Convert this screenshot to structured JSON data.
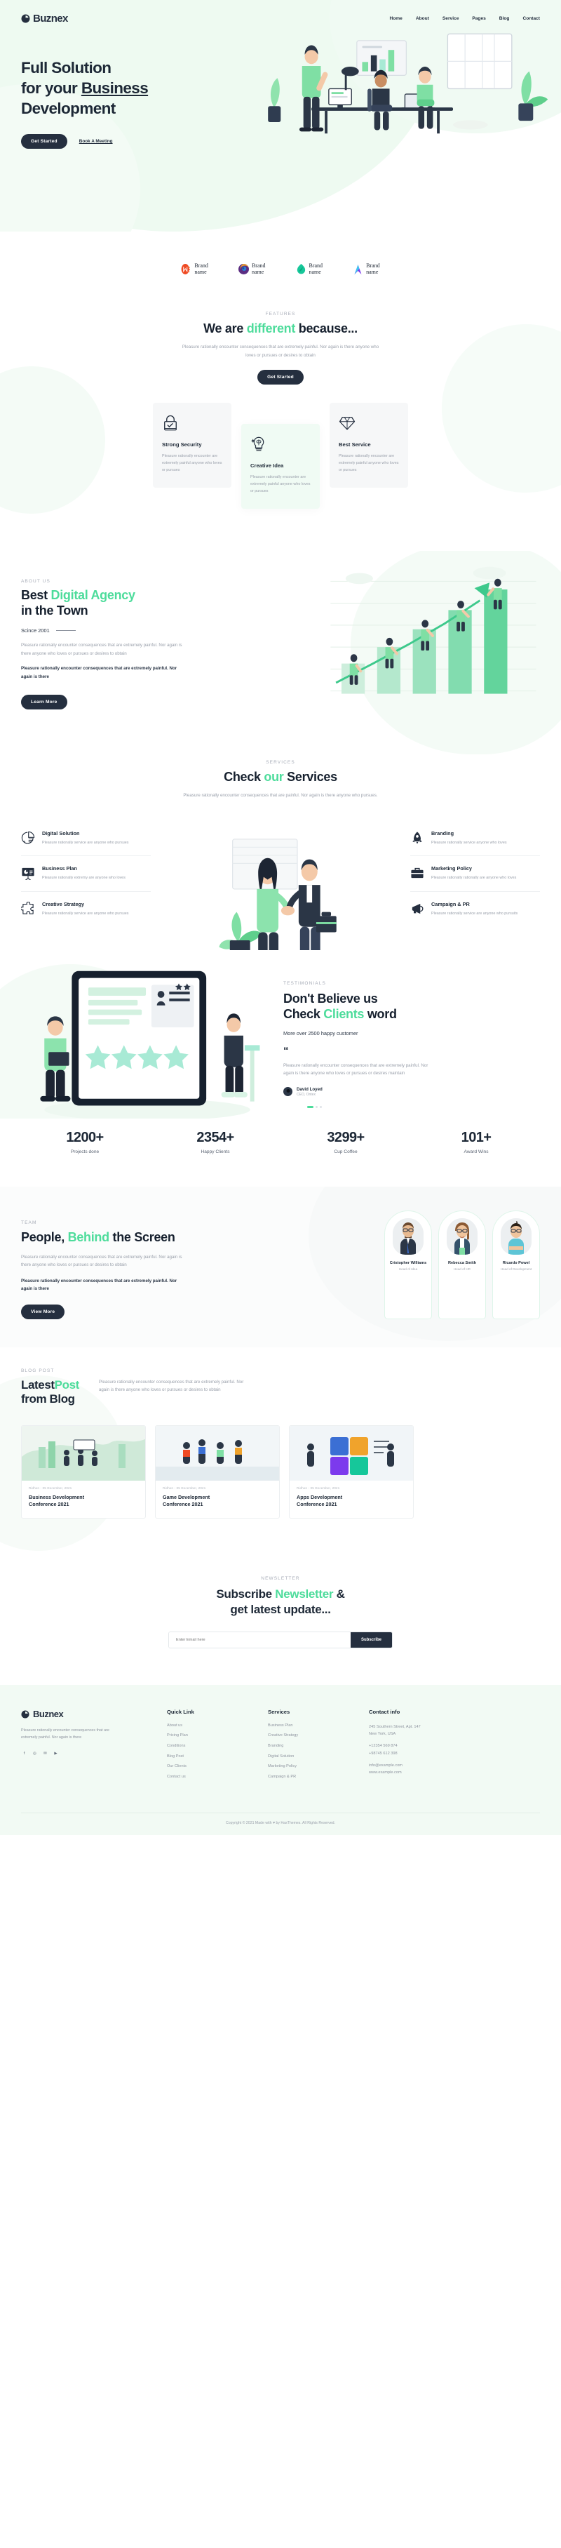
{
  "brand": {
    "name": "Buznex",
    "logo_icon": "circle-split-icon"
  },
  "nav": {
    "items": [
      {
        "label": "Home"
      },
      {
        "label": "About"
      },
      {
        "label": "Service"
      },
      {
        "label": "Pages"
      },
      {
        "label": "Blog"
      },
      {
        "label": "Contact"
      }
    ]
  },
  "hero": {
    "line1": "Full Solution",
    "line2_pre": "for your ",
    "line2_underlined": "Business",
    "line3": "Development",
    "primary_cta": "Get Started",
    "secondary_cta": "Book A Meeting"
  },
  "brands": {
    "items": [
      {
        "name_line1": "Brand",
        "name_line2": "name",
        "color": "#ef4a23",
        "icon": "m-dots-logo-icon"
      },
      {
        "name_line1": "Brand",
        "name_line2": "name",
        "color": "#3b6fd4",
        "icon": "swirl-logo-icon"
      },
      {
        "name_line1": "Brand",
        "name_line2": "name",
        "color": "#16c79a",
        "icon": "leaf-logo-icon"
      },
      {
        "name_line1": "Brand",
        "name_line2": "name",
        "color": "#7c3aed",
        "icon": "peak-logo-icon"
      }
    ]
  },
  "features": {
    "label": "FEATURES",
    "title_pre": "We are ",
    "title_accent": "different",
    "title_post": " because...",
    "subtitle": "Pleasure rationally encounter consequences that are extremely painful. Nor again is there anyone who loves or pursues or desires to obtain",
    "cta": "Get Started",
    "cards": [
      {
        "icon": "padlock-check-icon",
        "title": "Strong Security",
        "text": "Pleasure rationally encounter are extremely painful anyone who loves or pursues"
      },
      {
        "icon": "brain-bulb-icon",
        "title": "Creative Idea",
        "text": "Pleasure rationally encounter are extremely painful anyone who loves or pursues"
      },
      {
        "icon": "diamond-icon",
        "title": "Best Service",
        "text": "Pleasure rationally encounter are extremely painful anyone who loves or pursues"
      }
    ]
  },
  "about": {
    "label": "ABOUT US",
    "title_pre": "Best ",
    "title_accent": "Digital Agency",
    "title_post": "in the Town",
    "since": "Scince 2001",
    "paragraph1": "Pleasure rationally encounter consequences that are extremely painful. Nor again is there anyone who loves or pursues or desires to obtain",
    "paragraph2": "Pleasure rationally encounter consequences that are extremely painful. Nor again is there",
    "cta": "Learn More"
  },
  "services": {
    "label": "SERVICES",
    "title_pre": "Check ",
    "title_accent": "our",
    "title_post": " Services",
    "subtitle": "Pleasure rationally encounter consequences that are painful. Nor again is there anyone who pursues.",
    "left": [
      {
        "icon": "pie-chart-icon",
        "title": "Digital Solution",
        "text": "Pleasure rationally service are anyone who pursues"
      },
      {
        "icon": "presentation-board-icon",
        "title": "Business Plan",
        "text": "Pleasure rationally extremy are anyone who loves"
      },
      {
        "icon": "puzzle-icon",
        "title": "Creative Strategy",
        "text": "Pleasure rationally service are anyone who pursues"
      }
    ],
    "right": [
      {
        "icon": "rocket-icon",
        "title": "Branding",
        "text": "Pleasure rationally service anyone who loves"
      },
      {
        "icon": "briefcase-icon",
        "title": "Marketing Policy",
        "text": "Pleasure rationally rationally are anyone who loves"
      },
      {
        "icon": "megaphone-icon",
        "title": "Campaign & PR",
        "text": "Pleasure rationally service are anyone who pursuits"
      }
    ]
  },
  "testimonials": {
    "label": "TESTIMONIALS",
    "title_l1": "Don't Believe us",
    "title_l2_pre": "Check ",
    "title_l2_accent": "Clients",
    "title_l2_post": " word",
    "subtitle": "More over 2500 happy customer",
    "quote_mark": "“",
    "quote": "Pleasure rationally encounter consequences that are extremely painful. Nor again is there anyone who loves or pursues or desires maintain",
    "author_name": "David Loyed",
    "author_role": "CEO, Ontex"
  },
  "stats": [
    {
      "value": "1200+",
      "label": "Projects done"
    },
    {
      "value": "2354+",
      "label": "Happy Clients"
    },
    {
      "value": "3299+",
      "label": "Cup Coffee"
    },
    {
      "value": "101+",
      "label": "Award Wins"
    }
  ],
  "team": {
    "label": "TEAM",
    "title_pre": "People, ",
    "title_accent": "Behind",
    "title_post": " the Screen",
    "paragraph1": "Pleasure rationally encounter consequences that are extremely painful. Nor again is there anyone who loves or pursues or desires to obtain",
    "paragraph2": "Pleasure rationally encounter consequences that are extremely painful. Nor again is there",
    "cta": "View More",
    "members": [
      {
        "name": "Cristopher Williams",
        "role": "Head of Idea"
      },
      {
        "name": "Rebecca Smith",
        "role": "Head of HR"
      },
      {
        "name": "Ricardo Powel",
        "role": "Head of Development"
      }
    ]
  },
  "blog": {
    "label": "BLOG POST",
    "title_pre": "Latest",
    "title_accent": "Post",
    "title_post": "from Blog",
    "lead": "Pleasure rationally encounter consequences that are extremely painful. Nor again is there anyone who loves or pursues or desires to obtain",
    "posts": [
      {
        "meta": "Ridhon  -  05 December, 2021",
        "title_l1": "Business Development",
        "title_l2": "Conference 2021"
      },
      {
        "meta": "Ridhon  -  05 December, 2021",
        "title_l1": "Game Development",
        "title_l2": "Conference 2021"
      },
      {
        "meta": "Ridhon  -  05 December, 2021",
        "title_l1": "Apps Development",
        "title_l2": "Conference 2021"
      }
    ]
  },
  "newsletter": {
    "label": "NEWSLETTER",
    "title_pre": "Subscribe ",
    "title_accent": "Newsletter",
    "title_post": " &",
    "title_l2": "get latest update...",
    "placeholder": "Enter Email here",
    "value": "",
    "button": "Subscribe"
  },
  "footer": {
    "brand": "Buznex",
    "desc": "Pleasure rationally encounter consequences that are extremely painful. Nor again is there",
    "social": [
      "f",
      "◎",
      "✉",
      "▶"
    ],
    "quick_link": {
      "heading": "Quick Link",
      "items": [
        "About us",
        "Pricing Plan",
        "Conditions",
        "Blog Post",
        "Our Clients",
        "Contact us"
      ]
    },
    "services": {
      "heading": "Services",
      "items": [
        "Business Plan",
        "Creative Strategy",
        "Branding",
        "Digital Solution",
        "Marketing Policy",
        "Campaign & PR"
      ]
    },
    "contact": {
      "heading": "Contact info",
      "address_l1": "245 Southern Street, Apt. 147",
      "address_l2": "New York, USA",
      "phone1": "+12354 569 874",
      "phone2": "+98745 612 398",
      "email": "info@example.com",
      "website": "www.example.com"
    },
    "copyright": "Copyright © 2021 Made with ♥ by HasThemes. All Rights Reserved."
  },
  "colors": {
    "accent": "#4ddc9b",
    "dark": "#252f3f",
    "muted": "#9aa0ab",
    "mint_bg": "#eefaf1"
  }
}
